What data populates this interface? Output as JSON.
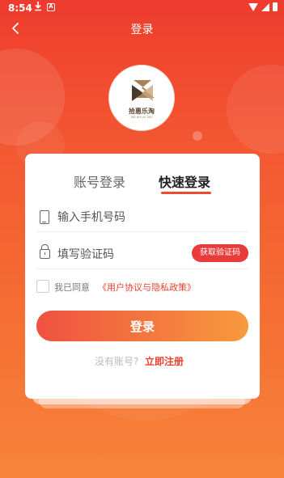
{
  "status_bar": {
    "time": "8:54",
    "download_icon": "download-icon",
    "a_label": "A"
  },
  "header": {
    "title": "登录",
    "back_icon": "chevron-left-icon"
  },
  "logo": {
    "name": "拾惠乐淘",
    "subtitle": "SHI HUI LE TAO"
  },
  "tabs": [
    {
      "label": "账号登录",
      "active": false
    },
    {
      "label": "快速登录",
      "active": true
    }
  ],
  "form": {
    "phone_placeholder": "输入手机号码",
    "code_placeholder": "填写验证码",
    "get_code_label": "获取验证码",
    "agree_prefix": "我已同意",
    "agree_link": "《用户协议与隐私政策》",
    "login_label": "登录",
    "no_account": "没有账号?",
    "register_label": "立即注册"
  },
  "colors": {
    "accent": "#ee3a2f",
    "button_start": "#ef5140",
    "button_end": "#f89a3c"
  }
}
